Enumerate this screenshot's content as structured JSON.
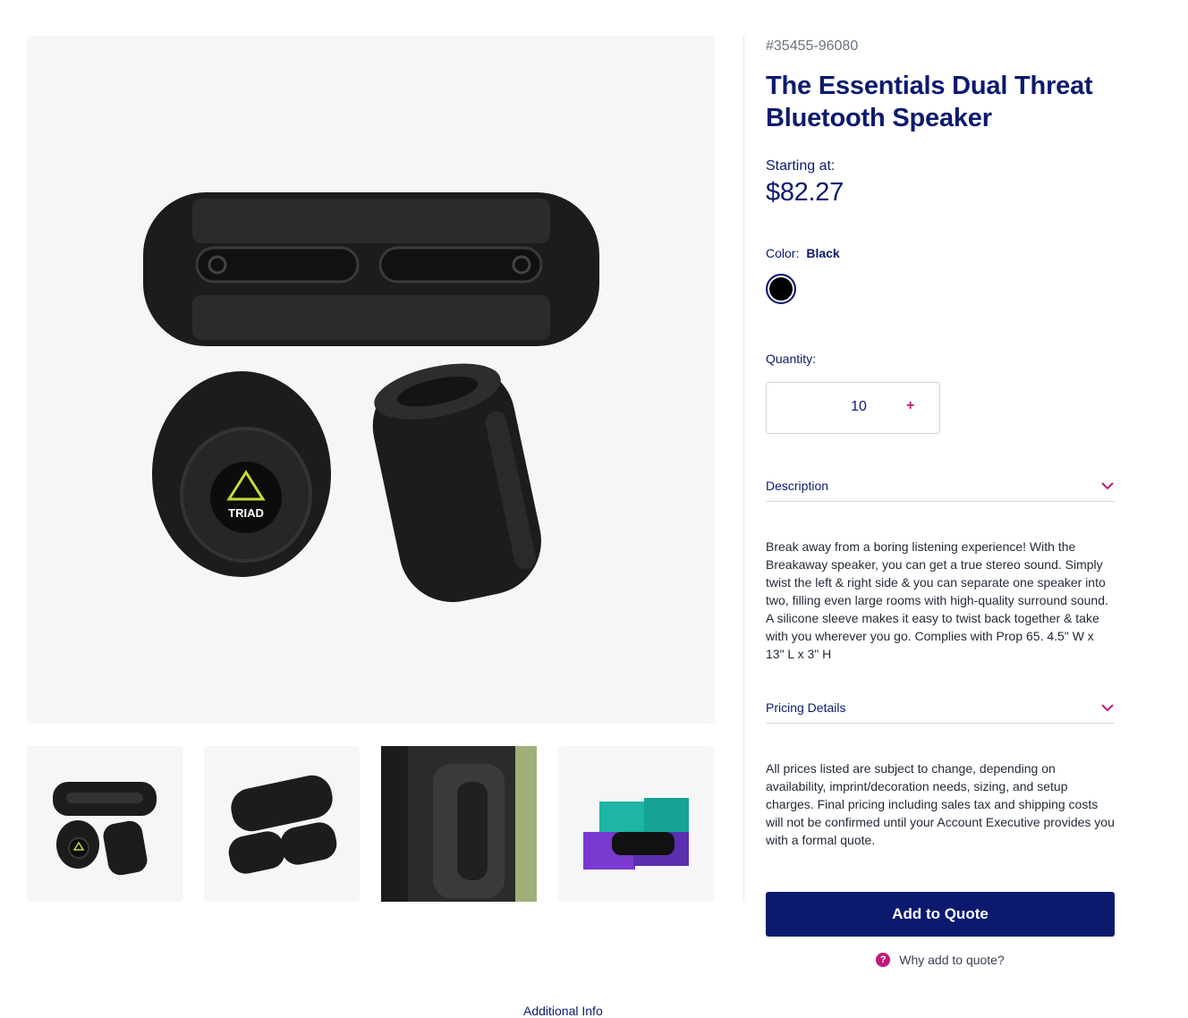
{
  "product": {
    "sku": "#35455-96080",
    "title": "The Essentials Dual Threat Bluetooth Speaker",
    "price_label": "Starting at:",
    "price": "$82.27",
    "color_label": "Color:",
    "color_value": "Black",
    "swatch_color": "#000000",
    "quantity_label": "Quantity:",
    "quantity_value": "10",
    "quantity_plus": "+",
    "main_image_logo_text": "TRIAD"
  },
  "accordions": {
    "description": {
      "title": "Description",
      "body": "Break away from a boring listening experience! With the Breakaway speaker, you can get a true stereo sound. Simply twist the left & right side & you can separate one speaker into two, filling even large rooms with high-quality surround sound. A silicone sleeve makes it easy to twist back together & take with you wherever you go. Complies with Prop 65. 4.5\" W x 13\" L x 3\" H"
    },
    "pricing": {
      "title": "Pricing Details",
      "body": "All prices listed are subject to change, depending on availability, imprint/decoration needs, sizing, and setup charges. Final pricing including sales tax and shipping costs will not be confirmed until your Account Executive provides you with a formal quote."
    }
  },
  "actions": {
    "add_to_quote": "Add to Quote",
    "why_add": "Why add to quote?",
    "why_icon": "?"
  },
  "footer": {
    "additional_info": "Additional Info"
  },
  "colors": {
    "brand_navy": "#0b1a6e",
    "accent_magenta": "#c2187a"
  }
}
